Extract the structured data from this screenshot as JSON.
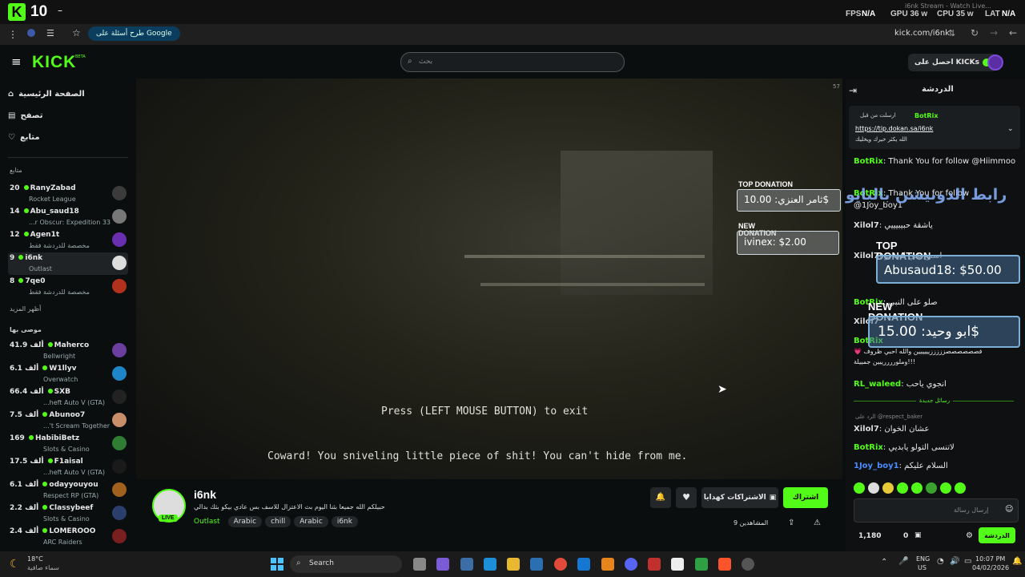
{
  "overlay": {
    "logo_badge": "10",
    "fps_label": "FPS",
    "fps_value": "N/A",
    "gpu": "GPU 36 w",
    "cpu": "CPU 35 w",
    "lat_label": "LAT",
    "lat_value": "N/A",
    "window_title": "i6nk Stream - Watch Live..."
  },
  "browser": {
    "google_chip": "طرح أسئلة على Google",
    "url": "kick.com/i6nk"
  },
  "kick": {
    "logo": "KICK",
    "beta": "BETA",
    "search_placeholder": "بحث",
    "get_kicks": "احصل على KICKs"
  },
  "sidebar": {
    "nav": [
      {
        "label": "الصفحة الرئيسية",
        "icon": "home-icon"
      },
      {
        "label": "تصفح",
        "icon": "browse-icon"
      },
      {
        "label": "متابع",
        "icon": "heart-icon"
      }
    ],
    "following_title": "متابع",
    "following": [
      {
        "viewers": "20",
        "name": "RanyZabad",
        "game": "Rocket League"
      },
      {
        "viewers": "14",
        "name": "Abu_saud18",
        "game": "...r Obscur: Expedition 33"
      },
      {
        "viewers": "12",
        "name": "Agen1t",
        "game": "مخصصة للدردشة فقط"
      },
      {
        "viewers": "9",
        "name": "i6nk",
        "game": "Outlast"
      },
      {
        "viewers": "8",
        "name": "7qe0",
        "game": "مخصصة للدردشة فقط"
      }
    ],
    "show_more": "أظهر المزيد",
    "recommended_title": "موصى بها",
    "recommended": [
      {
        "viewers": "41.9 ألف",
        "name": "Maherco",
        "game": "Bellwright"
      },
      {
        "viewers": "6.1 ألف",
        "name": "W1llyv",
        "game": "Overwatch"
      },
      {
        "viewers": "66.4 ألف",
        "name": "SXB",
        "game": "...heft Auto V (GTA)"
      },
      {
        "viewers": "7.5 ألف",
        "name": "Abunoo7",
        "game": "...'t Scream Together"
      },
      {
        "viewers": "169",
        "name": "HabibiBetz",
        "game": "Slots & Casino"
      },
      {
        "viewers": "17.5 ألف",
        "name": "F1aisal",
        "game": "...heft Auto V (GTA)"
      },
      {
        "viewers": "6.1 ألف",
        "name": "odayyouyou",
        "game": "Respect RP (GTA)"
      },
      {
        "viewers": "2.2 ألف",
        "name": "Classybeef",
        "game": "Slots & Casino"
      },
      {
        "viewers": "2.4 ألف",
        "name": "LOMEROOO",
        "game": "ARC Raiders"
      }
    ]
  },
  "video": {
    "press_text": "Press (LEFT MOUSE BUTTON) to exit",
    "subtitle": "Coward! You sniveling little piece of shit! You can't hide from me.",
    "top_donation_label": "TOP DONATION",
    "top_donation_value": "ثامر العنزي: 10.00$",
    "new_donation_label": "NEW DONATION",
    "new_donation_value": "ivinex: $2.00",
    "corner_number": "57"
  },
  "stream_info": {
    "streamer": "i6nk",
    "live_badge": "LIVE",
    "title": "حبيلكم الله جميعا بثنا اليوم بث الاعتزال للاسف بس عادي بيكو بثك بدالي",
    "category": "Outlast",
    "tags": [
      "Arabic",
      "chill",
      "Arabic",
      "i6nk"
    ],
    "subscribe": "اشتراك",
    "gift_subs": "الاشتراكات كهدايا",
    "viewers": "9 المشاهدين"
  },
  "chat": {
    "title": "الدردشة",
    "pinned_by": "BotRix",
    "pinned_label": "ارسلت من قبل",
    "pinned_link": "https://tip.dokan.sa/i6nk",
    "pinned_text": "الله يكثر خيرك ويخليك",
    "messages": [
      {
        "user": "BotRix",
        "text": "Thank You for follow @Hiimmoo"
      },
      {
        "user": "BotRix",
        "text": "Thank You for follow @1Joy_boy1"
      },
      {
        "user": "Xilol7",
        "text": "ياشقة حبيبيييي"
      },
      {
        "user": "Xilol7",
        "text": "اسمع شي انت بو"
      },
      {
        "user": "BotRix",
        "text": "صلو على النبي"
      },
      {
        "user": "Xilol7",
        "text": ""
      },
      {
        "user": "BotRix",
        "text": ""
      },
      {
        "user": "",
        "text": "فصصصصصصزززززيييييين والله احبي ظروف 💗 وملوررررييين جمييلة!!!"
      },
      {
        "user": "RL_waleed",
        "text": "انجوي ياحب"
      }
    ],
    "new_messages": "رسائل جديدة",
    "reply_to": "الرد على @respect_baker",
    "messages2": [
      {
        "user": "Xilol7",
        "text": "عشان الخوان"
      },
      {
        "user": "BotRix",
        "text": "لاتنسى التولو يابديي"
      },
      {
        "user": "1Joy_boy1",
        "text": "السلام عليكم"
      }
    ],
    "input_placeholder": "إرسال رسالة",
    "points": "1,180",
    "zero": "0",
    "send": "الدردشة",
    "overlay_link": "رابط الدونيشن بالبايو",
    "overlay_top_label": "TOP DONATION",
    "overlay_top_value": "Abusaud18: $50.00",
    "overlay_new_label": "NEW DONATION",
    "overlay_new_value": "ابو وحيد: 15.00$"
  },
  "taskbar": {
    "temp": "18°C",
    "weather": "سماء صافية",
    "search": "Search",
    "lang1": "ENG",
    "lang2": "US",
    "time": "10:07 PM",
    "date": "04/02/2026"
  },
  "colors": {
    "accent": "#53fc18",
    "bg": "#0b0e0f"
  }
}
